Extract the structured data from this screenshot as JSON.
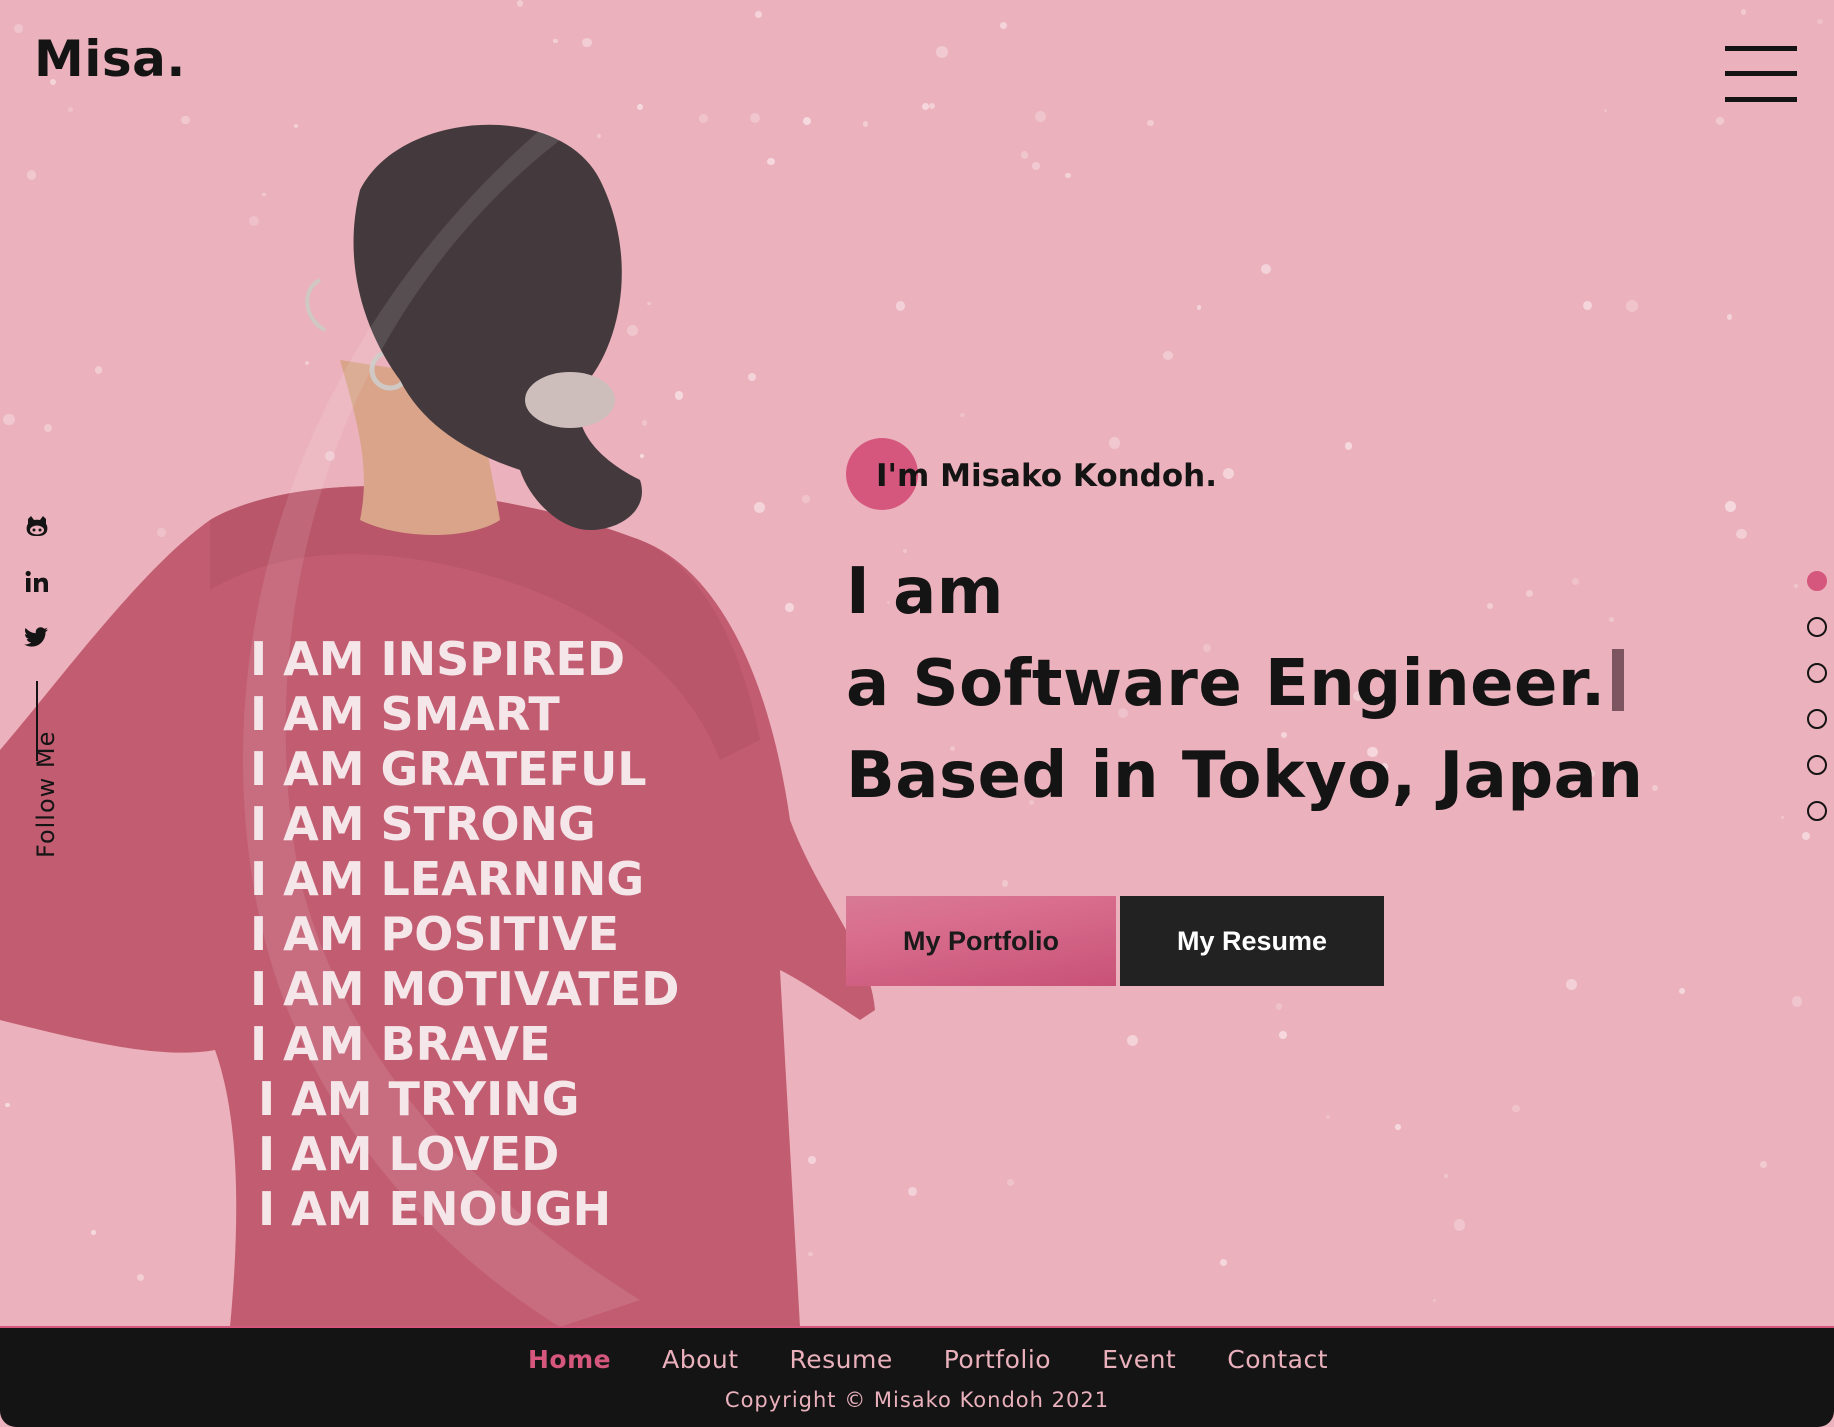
{
  "brand": {
    "logo": "Misa."
  },
  "social": {
    "follow_label": "Follow Me",
    "icons": [
      "github-icon",
      "linkedin-icon",
      "twitter-icon"
    ]
  },
  "hero": {
    "intro": "I'm Misako Kondoh.",
    "line1": "I am",
    "line2": "a Software Engineer.",
    "line3": "Based in Tokyo, Japan",
    "portfolio_button": "My Portfolio",
    "resume_button": "My Resume"
  },
  "shirt": {
    "lines": [
      "I AM INSPIRED",
      "I AM SMART",
      "I AM GRATEFUL",
      "I AM STRONG",
      "I AM LEARNING",
      "I AM POSITIVE",
      "I AM MOTIVATED",
      "I AM BRAVE",
      "I AM TRYING",
      "I AM LOVED",
      "I AM ENOUGH"
    ]
  },
  "section_nav": {
    "count": 6,
    "active_index": 0
  },
  "footer": {
    "nav": [
      "Home",
      "About",
      "Resume",
      "Portfolio",
      "Event",
      "Contact"
    ],
    "active": "Home",
    "copyright": "Copyright © Misako Kondoh 2021"
  },
  "colors": {
    "background": "#ebb1bc",
    "accent": "#d6577d",
    "dark": "#141414",
    "footer_text": "#eab1bd"
  }
}
